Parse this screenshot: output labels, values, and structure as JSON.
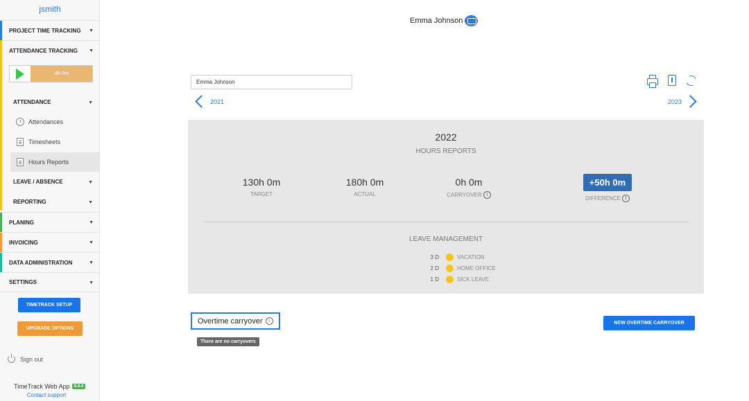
{
  "sidebar": {
    "username": "jsmith",
    "nav": [
      {
        "label": "Project Time Tracking",
        "color": "#2d7bd4"
      },
      {
        "label": "Attendance Tracking",
        "color": "#f1c40f"
      },
      {
        "label": "Planing",
        "color": "#4caf50"
      },
      {
        "label": "Invoicing",
        "color": "#ee9a3b"
      },
      {
        "label": "Data Administration",
        "color": "#1abc9c"
      },
      {
        "label": "Settings",
        "color": ""
      }
    ],
    "timer": {
      "value": "-8h 0m",
      "play_color": "#2ecc40",
      "bar_color": "#e9b674"
    },
    "attendance": {
      "label": "Attendance",
      "items": [
        {
          "label": "Attendances",
          "icon": "stopwatch-icon"
        },
        {
          "label": "Timesheets",
          "icon": "document-icon"
        },
        {
          "label": "Hours Reports",
          "icon": "document-icon",
          "active": true
        }
      ]
    },
    "leave_absence": {
      "label": "Leave / Absence"
    },
    "reporting": {
      "label": "Reporting"
    },
    "setup_button": "TIMETRACK SETUP",
    "upgrade_button": "UPGRADE OPTIONS",
    "sign_out": "Sign out",
    "app_name": "TimeTrack Web App",
    "version": "6.4.4",
    "contact": "Contact support"
  },
  "main": {
    "person_name": "Emma Johnson",
    "employee_input_value": "Emma Johnson",
    "prev_year": "2021",
    "next_year": "2023",
    "report": {
      "year": "2022",
      "subtitle": "Hours Reports",
      "stats": [
        {
          "value": "130h 0m",
          "label": "Target"
        },
        {
          "value": "180h 0m",
          "label": "Actual"
        },
        {
          "value": "0h 0m",
          "label": "Carryover"
        },
        {
          "value": "+50h 0m",
          "label": "Difference"
        }
      ],
      "leave_title": "Leave Management",
      "leave": [
        {
          "count": "3 D",
          "label": "Vacation",
          "color": "#f5c518"
        },
        {
          "count": "2 D",
          "label": "Home Office",
          "color": "#f5c518"
        },
        {
          "count": "1 D",
          "label": "Sick Leave",
          "color": "#f5c518"
        }
      ]
    },
    "overtime": {
      "title": "Overtime carryover",
      "empty_message": "There are no carryovers",
      "new_button": "NEW OVERTIME CARRYOVER"
    }
  },
  "colors": {
    "accent": "#2d7bd4",
    "primary_button": "#1a73e8",
    "difference": "#2f6db5"
  }
}
